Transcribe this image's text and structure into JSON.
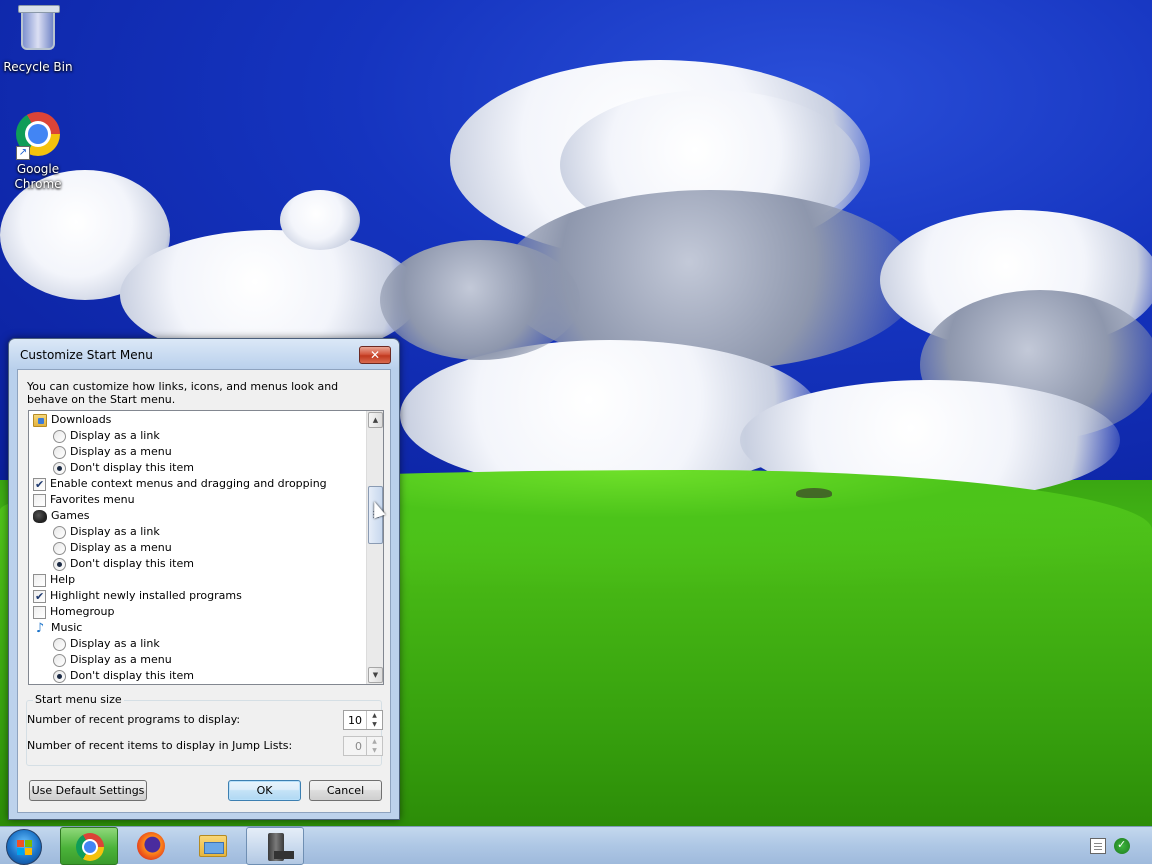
{
  "desktop": {
    "icons": [
      {
        "label": "Recycle Bin",
        "icon": "recycle-bin-icon"
      },
      {
        "label": "Google Chrome",
        "icon": "chrome-icon"
      }
    ]
  },
  "dialog": {
    "title": "Customize Start Menu",
    "close_label": "✕",
    "intro": "You can customize how links, icons, and menus look and behave on the Start menu.",
    "items": [
      {
        "type": "header",
        "icon": "folder-icon",
        "label": "Downloads"
      },
      {
        "type": "radio",
        "label": "Display as a link",
        "checked": false
      },
      {
        "type": "radio",
        "label": "Display as a menu",
        "checked": false
      },
      {
        "type": "radio",
        "label": "Don't display this item",
        "checked": true
      },
      {
        "type": "check",
        "label": "Enable context menus and dragging and dropping",
        "checked": true
      },
      {
        "type": "check",
        "label": "Favorites menu",
        "checked": false
      },
      {
        "type": "header",
        "icon": "games-icon",
        "label": "Games"
      },
      {
        "type": "radio",
        "label": "Display as a link",
        "checked": false
      },
      {
        "type": "radio",
        "label": "Display as a menu",
        "checked": false
      },
      {
        "type": "radio",
        "label": "Don't display this item",
        "checked": true
      },
      {
        "type": "check",
        "label": "Help",
        "checked": false
      },
      {
        "type": "check",
        "label": "Highlight newly installed programs",
        "checked": true
      },
      {
        "type": "check",
        "label": "Homegroup",
        "checked": false
      },
      {
        "type": "header",
        "icon": "music-icon",
        "label": "Music"
      },
      {
        "type": "radio",
        "label": "Display as a link",
        "checked": false
      },
      {
        "type": "radio",
        "label": "Display as a menu",
        "checked": false
      },
      {
        "type": "radio",
        "label": "Don't display this item",
        "checked": true
      }
    ],
    "size_group": {
      "title": "Start menu size",
      "recent_programs_label": "Number of recent programs to display:",
      "recent_programs_value": "10",
      "jump_list_label": "Number of recent items to display in Jump Lists:",
      "jump_list_value": "0"
    },
    "buttons": {
      "defaults": "Use Default Settings",
      "ok": "OK",
      "cancel": "Cancel"
    }
  },
  "taskbar": {
    "items": [
      {
        "name": "chrome",
        "icon": "chrome-icon"
      },
      {
        "name": "firefox",
        "icon": "firefox-icon"
      },
      {
        "name": "explorer",
        "icon": "folder-icon"
      },
      {
        "name": "server-manager",
        "icon": "server-icon"
      }
    ],
    "tray": [
      "document-icon",
      "network-icon"
    ]
  }
}
